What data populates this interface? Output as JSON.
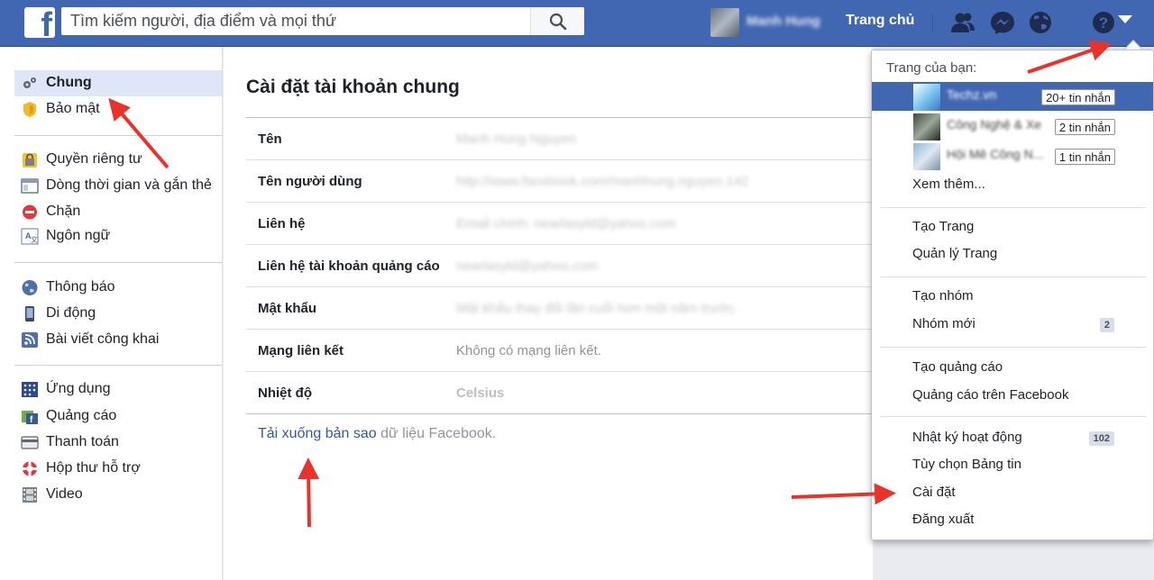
{
  "topbar": {
    "logo": "f",
    "search_placeholder": "Tìm kiếm người, địa điểm và mọi thứ",
    "search_icon": "search-icon",
    "profile_name": "Manh Hung",
    "home": "Trang chủ",
    "icons": [
      "friend-requests-icon",
      "messenger-icon",
      "notifications-globe-icon",
      "help-icon",
      "account-dropdown-icon"
    ],
    "color_bar": "#4267b2"
  },
  "leftnav": {
    "groups": [
      [
        {
          "label": "Chung",
          "icon": "gears-icon",
          "active": true
        },
        {
          "label": "Bảo mật",
          "icon": "shield-icon"
        }
      ],
      [
        {
          "label": "Quyền riêng tư",
          "icon": "lock-icon"
        },
        {
          "label": "Dòng thời gian và gắn thẻ",
          "icon": "timeline-icon"
        },
        {
          "label": "Chặn",
          "icon": "block-icon"
        },
        {
          "label": "Ngôn ngữ",
          "icon": "language-icon"
        }
      ],
      [
        {
          "label": "Thông báo",
          "icon": "globe-icon"
        },
        {
          "label": "Di động",
          "icon": "mobile-icon"
        },
        {
          "label": "Bài viết công khai",
          "icon": "rss-icon"
        }
      ],
      [
        {
          "label": "Ứng dụng",
          "icon": "apps-icon"
        },
        {
          "label": "Quảng cáo",
          "icon": "ads-icon"
        },
        {
          "label": "Thanh toán",
          "icon": "credit-card-icon"
        },
        {
          "label": "Hộp thư hỗ trợ",
          "icon": "lifebuoy-icon"
        },
        {
          "label": "Video",
          "icon": "film-icon"
        }
      ]
    ]
  },
  "main": {
    "title": "Cài đặt tài khoản chung",
    "rows": [
      {
        "key": "Tên",
        "value": "Manh Hung Nguyen",
        "blurred": true
      },
      {
        "key": "Tên người dùng",
        "value": "http://www.facebook.com/manhhung.nguyen.142",
        "blurred": true
      },
      {
        "key": "Liên hệ",
        "value": "Email chính: nearlasyld@yahoo.com",
        "blurred": true
      },
      {
        "key": "Liên hệ tài khoản quảng cáo",
        "value": "nearlasyld@yahoo.com",
        "blurred": true
      },
      {
        "key": "Mật khẩu",
        "value": "Mật khẩu thay đổi lần cuối hơn một năm trước.",
        "blurred": true
      },
      {
        "key": "Mạng liên kết",
        "value": "Không có mạng liên kết."
      },
      {
        "key": "Nhiệt độ",
        "value": "Celsius",
        "bold": true
      }
    ],
    "download_link": "Tải xuống bản sao",
    "download_suffix": " dữ liệu Facebook."
  },
  "dropdown": {
    "header": "Trang của bạn:",
    "pages": [
      {
        "name": "Techz.vn",
        "badge": "20+ tin nhắn",
        "selected": true
      },
      {
        "name": "Công Nghệ & Xe",
        "badge": "2 tin nhắn"
      },
      {
        "name": "Hội Mê Công N...",
        "badge": "1 tin nhắn"
      }
    ],
    "see_more": "Xem thêm...",
    "groups": [
      [
        {
          "label": "Tạo Trang"
        },
        {
          "label": "Quản lý Trang"
        }
      ],
      [
        {
          "label": "Tạo nhóm"
        },
        {
          "label": "Nhóm mới",
          "count": "2"
        }
      ],
      [
        {
          "label": "Tạo quảng cáo"
        },
        {
          "label": "Quảng cáo trên Facebook"
        }
      ],
      [
        {
          "label": "Nhật ký hoạt động",
          "count": "102"
        },
        {
          "label": "Tùy chọn Bảng tin"
        },
        {
          "label": "Cài đặt"
        },
        {
          "label": "Đăng xuất"
        }
      ]
    ]
  },
  "annotation_color": "#e8322b"
}
